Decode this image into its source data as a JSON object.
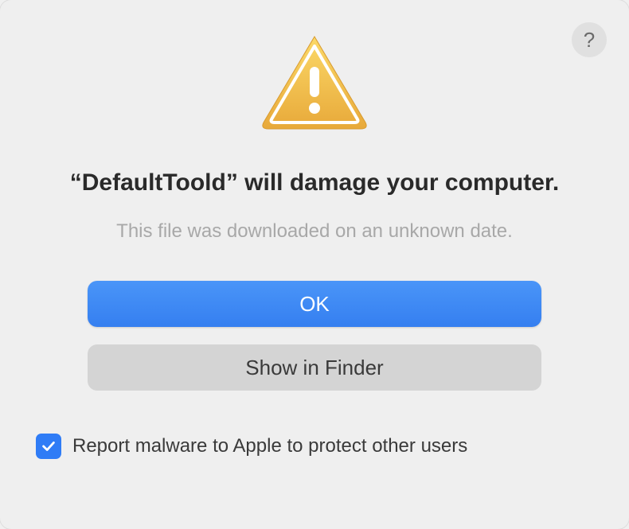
{
  "help_label": "?",
  "title": "“DefaultToold” will damage your computer.",
  "subtitle": "This file was downloaded on an unknown date.",
  "buttons": {
    "primary": "OK",
    "secondary": "Show in Finder"
  },
  "checkbox": {
    "checked": true,
    "label": "Report malware to Apple to protect other users"
  }
}
